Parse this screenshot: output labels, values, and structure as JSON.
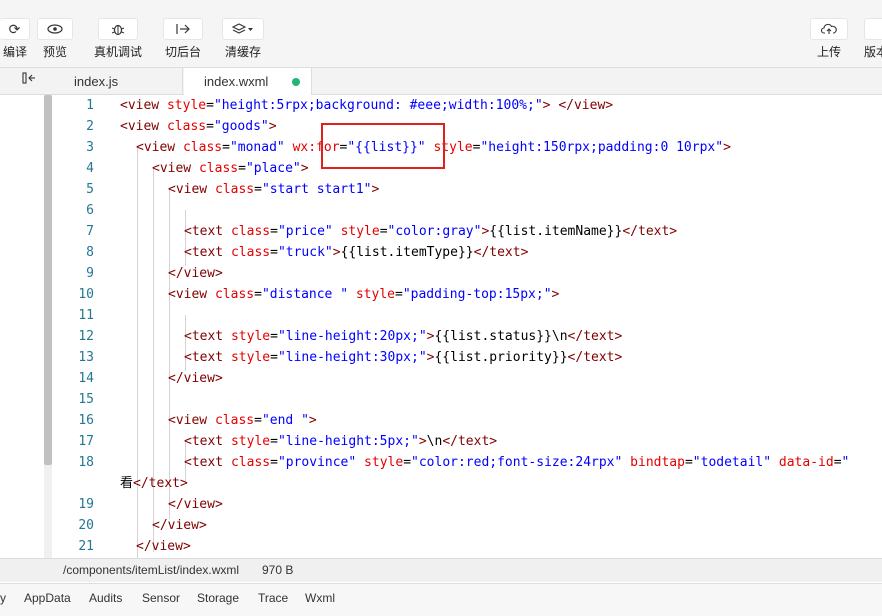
{
  "toolbar": {
    "compile_label": "编译",
    "preview_label": "预览",
    "device_debug_label": "真机调试",
    "background_label": "切后台",
    "clear_cache_label": "清缓存",
    "upload_label": "上传",
    "version_label": "版本"
  },
  "tabs": [
    {
      "label": "index.js"
    },
    {
      "label": "index.wxml"
    }
  ],
  "editor": {
    "lines": [
      {
        "n": "1"
      },
      {
        "n": "2"
      },
      {
        "n": "3"
      },
      {
        "n": "4"
      },
      {
        "n": "5"
      },
      {
        "n": "6"
      },
      {
        "n": "7"
      },
      {
        "n": "8"
      },
      {
        "n": "9"
      },
      {
        "n": "10"
      },
      {
        "n": "11"
      },
      {
        "n": "12"
      },
      {
        "n": "13"
      },
      {
        "n": "14"
      },
      {
        "n": "15"
      },
      {
        "n": "16"
      },
      {
        "n": "17"
      },
      {
        "n": "18"
      },
      {
        "n": "19"
      },
      {
        "n": "20"
      },
      {
        "n": "21"
      }
    ],
    "tokens": {
      "l1": [
        "<view ",
        "style",
        "=",
        "\"height:5rpx;background: #eee;width:100%;\"",
        "> </view>"
      ],
      "l2": [
        "<view ",
        "class",
        "=",
        "\"goods\"",
        ">"
      ],
      "l3": [
        "<view ",
        "class",
        "=",
        "\"monad\"",
        " ",
        "wx:for",
        "=",
        "\"{{list}}\"",
        " ",
        "style",
        "=",
        "\"height:150rpx;padding:0 10rpx\"",
        ">"
      ],
      "l4": [
        "<view ",
        "class",
        "=",
        "\"place\"",
        ">"
      ],
      "l5": [
        "<view ",
        "class",
        "=",
        "\"start start1\"",
        ">"
      ],
      "l7": [
        "<text ",
        "class",
        "=",
        "\"price\"",
        " ",
        "style",
        "=",
        "\"color:gray\"",
        ">",
        "{{list.itemName}}",
        "</text>"
      ],
      "l8": [
        "<text ",
        "class",
        "=",
        "\"truck\"",
        ">",
        "{{list.itemType}}",
        "</text>"
      ],
      "l9": [
        "</view>"
      ],
      "l10": [
        "<view ",
        "class",
        "=",
        "\"distance \"",
        " ",
        "style",
        "=",
        "\"padding-top:15px;\"",
        ">"
      ],
      "l12": [
        "<text ",
        "style",
        "=",
        "\"line-height:20px;\"",
        ">",
        "{{list.status}}\\n",
        "</text>"
      ],
      "l13": [
        "<text ",
        "style",
        "=",
        "\"line-height:30px;\"",
        ">",
        "{{list.priority}}",
        "</text>"
      ],
      "l14": [
        "</view>"
      ],
      "l16": [
        "<view ",
        "class",
        "=",
        "\"end \"",
        ">"
      ],
      "l17": [
        "<text ",
        "style",
        "=",
        "\"line-height:5px;\"",
        ">",
        "\\n",
        "</text>"
      ],
      "l18": [
        "<text ",
        "class",
        "=",
        "\"province\"",
        " ",
        "style",
        "=",
        "\"color:red;font-size:24rpx\"",
        " ",
        "bindtap",
        "=",
        "\"todetail\"",
        " ",
        "data-id",
        "=",
        "\""
      ],
      "l18b": [
        "看",
        "</text>"
      ],
      "l19": [
        "</view>"
      ],
      "l20": [
        "</view>"
      ],
      "l21": [
        "</view>"
      ]
    }
  },
  "status_bar": {
    "file_path": "/components/itemList/index.wxml",
    "file_size": "970 B"
  },
  "bottom_tabs": [
    {
      "label": "y"
    },
    {
      "label": "AppData"
    },
    {
      "label": "Audits"
    },
    {
      "label": "Sensor"
    },
    {
      "label": "Storage"
    },
    {
      "label": "Trace"
    },
    {
      "label": "Wxml"
    }
  ],
  "colors": {
    "tag": "#800000",
    "attribute": "#e50000",
    "value": "#0000ff",
    "line_number": "#237893",
    "highlight_box": "#e0201c",
    "modified_dot": "#22b573"
  }
}
